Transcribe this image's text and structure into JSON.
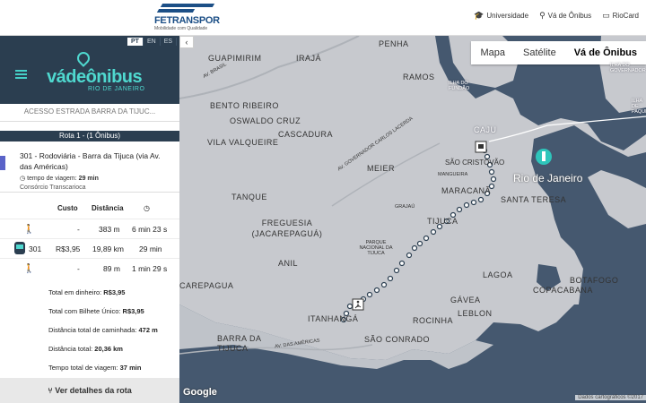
{
  "header": {
    "logo_name": "FETRANSPOR",
    "logo_slogan": "Mobilidade com Qualidade",
    "nav": [
      {
        "icon": "graduation-cap-icon",
        "label": "Universidade"
      },
      {
        "icon": "map-pin-icon",
        "label": "Vá de Ônibus"
      },
      {
        "icon": "card-icon",
        "label": "RioCard"
      }
    ]
  },
  "sidebar": {
    "languages": [
      "PT",
      "EN",
      "ES"
    ],
    "active_language": "PT",
    "collapse_icon": "chevron-left-icon",
    "brand_name": "vádeônibus",
    "brand_sub": "RIO DE JANEIRO",
    "search_value": "ACESSO ESTRADA BARRA DA TIJUC...",
    "route_header": "Rota 1 - (1 Ônibus)",
    "route": {
      "name": "301 - Rodoviária - Barra da Tijuca (via Av. das Américas)",
      "time_label": "tempo de viagem:",
      "time_value": "29 min",
      "operator": "Consórcio Transcarioca"
    },
    "table": {
      "headers": [
        "Custo",
        "Distância"
      ],
      "rows": [
        {
          "mode": "walk",
          "line": "",
          "cost": "-",
          "distance": "383 m",
          "time": "6 min 23 s"
        },
        {
          "mode": "bus",
          "line": "301",
          "cost": "R$3,95",
          "distance": "19,89 km",
          "time": "29 min"
        },
        {
          "mode": "walk",
          "line": "",
          "cost": "-",
          "distance": "89 m",
          "time": "1 min 29 s"
        }
      ]
    },
    "summary": [
      {
        "label": "Total em dinheiro: ",
        "value": "R$3,95"
      },
      {
        "label": "Total com Bilhete Único: ",
        "value": "R$3,95"
      },
      {
        "label": "Distância total de caminhada: ",
        "value": "472 m"
      },
      {
        "label": "Distância total: ",
        "value": "20,36 km"
      },
      {
        "label": "Tempo total de viagem: ",
        "value": "37 min"
      }
    ],
    "details_button": "Ver detalhes da rota"
  },
  "map": {
    "type_options": [
      "Mapa",
      "Satélite",
      "Vá de Ônibus"
    ],
    "active_type": "Vá de Ônibus",
    "google_logo": "Google",
    "attribution": "Dados cartográficos ©2017",
    "labels": [
      "GUAPIMIRIM",
      "PENHA",
      "IRAJÁ",
      "BENTO RIBEIRO",
      "OSWALDO CRUZ",
      "CASCADURA",
      "VILA VALQUEIRE",
      "MEIER",
      "SÃO CRISTÓVÃO",
      "MARACANÃ",
      "SANTA TERESA",
      "TANQUE",
      "FREGUESIA (JACAREPAGUÁ)",
      "ANIL",
      "CAREPAGUA",
      "TIJUCA",
      "BOTAFOGO",
      "LAGOA",
      "COPACABANA",
      "GÁVEA",
      "ROCINHA",
      "LEBLON",
      "ITANHANGÁ",
      "SÃO CONRADO",
      "BARRA DA TIJUCA",
      "RAMOS",
      "Rio de Janeiro",
      "Parque Nacional da Tijuca",
      "Av. Brasil",
      "Av. das Américas",
      "Av. Governador Carlos Lacerda",
      "CAJU",
      "MANGUEIRA",
      "GRAJAÚ",
      "Ilha do Fundão",
      "Ilha de Paquetá",
      "Ilha do Governador"
    ]
  }
}
